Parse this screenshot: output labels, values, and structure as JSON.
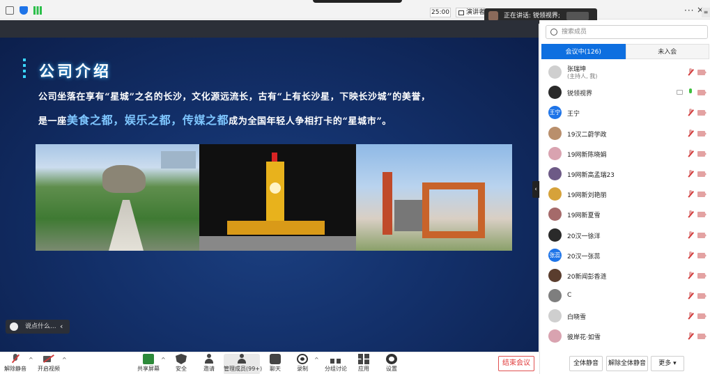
{
  "topbar": {
    "time": "25:00",
    "speaker_view": "演讲者",
    "talking": "正在讲话: 锐领视界;",
    "more": "···",
    "close": "×",
    "panel_menu": "≡"
  },
  "slide": {
    "title": "公司介绍",
    "line1": "公司坐落在享有“星城”之名的长沙，文化源远流长，古有“上有长沙星，下映长沙城”的美誉，",
    "line2_prefix": "是一座",
    "hl1": "美食之都，",
    "hl2": "娱乐之都，",
    "hl3": "传媒之都",
    "line2_suffix": "成为全国年轻人争相打卡的“星城市”。"
  },
  "chat": {
    "placeholder": "说点什么..."
  },
  "participants": {
    "search_placeholder": "搜索成员",
    "tab_in_meeting": "会议中(126)",
    "tab_not_joined": "未入会",
    "rows": [
      {
        "name": "张瑞坤",
        "sub": "(主持人, 我)",
        "avatar": "",
        "mic": "muted"
      },
      {
        "name": "锐领视界",
        "sub": "",
        "avatar": "",
        "mic": "on"
      },
      {
        "name": "王宁",
        "sub": "",
        "avatar": "王宁",
        "mic": "muted"
      },
      {
        "name": "19汉二蔚学政",
        "sub": "",
        "avatar": "",
        "mic": "muted"
      },
      {
        "name": "19网新陈晓娟",
        "sub": "",
        "avatar": "",
        "mic": "muted"
      },
      {
        "name": "19网新高孟瑞23",
        "sub": "",
        "avatar": "",
        "mic": "muted"
      },
      {
        "name": "19网新刘艳丽",
        "sub": "",
        "avatar": "",
        "mic": "muted"
      },
      {
        "name": "19网新夏雪",
        "sub": "",
        "avatar": "",
        "mic": "muted"
      },
      {
        "name": "20汉一徐洋",
        "sub": "",
        "avatar": "",
        "mic": "muted"
      },
      {
        "name": "20汉一张蕊",
        "sub": "",
        "avatar": "张蕊",
        "mic": "muted"
      },
      {
        "name": "20新闻彭香涟",
        "sub": "",
        "avatar": "",
        "mic": "muted"
      },
      {
        "name": "C",
        "sub": "",
        "avatar": "",
        "mic": "muted"
      },
      {
        "name": "白晓雪",
        "sub": "",
        "avatar": "",
        "mic": "muted"
      },
      {
        "name": "彼岸花·如雪",
        "sub": "",
        "avatar": "",
        "mic": "muted"
      }
    ],
    "mute_all": "全体静音",
    "unmute_all": "解除全体静音",
    "more": "更多 ▾"
  },
  "toolbar": {
    "unmute": "解除静音",
    "start_video": "开启视频",
    "share_screen": "共享屏幕",
    "security": "安全",
    "invite": "邀请",
    "manage_members": "管理成员(99+)",
    "chat": "聊天",
    "record": "录制",
    "breakout": "分组讨论",
    "apps": "应用",
    "settings": "设置",
    "end_meeting": "结束会议"
  },
  "colors": {
    "accent": "#0e6fe0",
    "end_button": "#e03a3a",
    "slide_bg": "#13306a",
    "slide_highlight": "#7ec6ff"
  }
}
